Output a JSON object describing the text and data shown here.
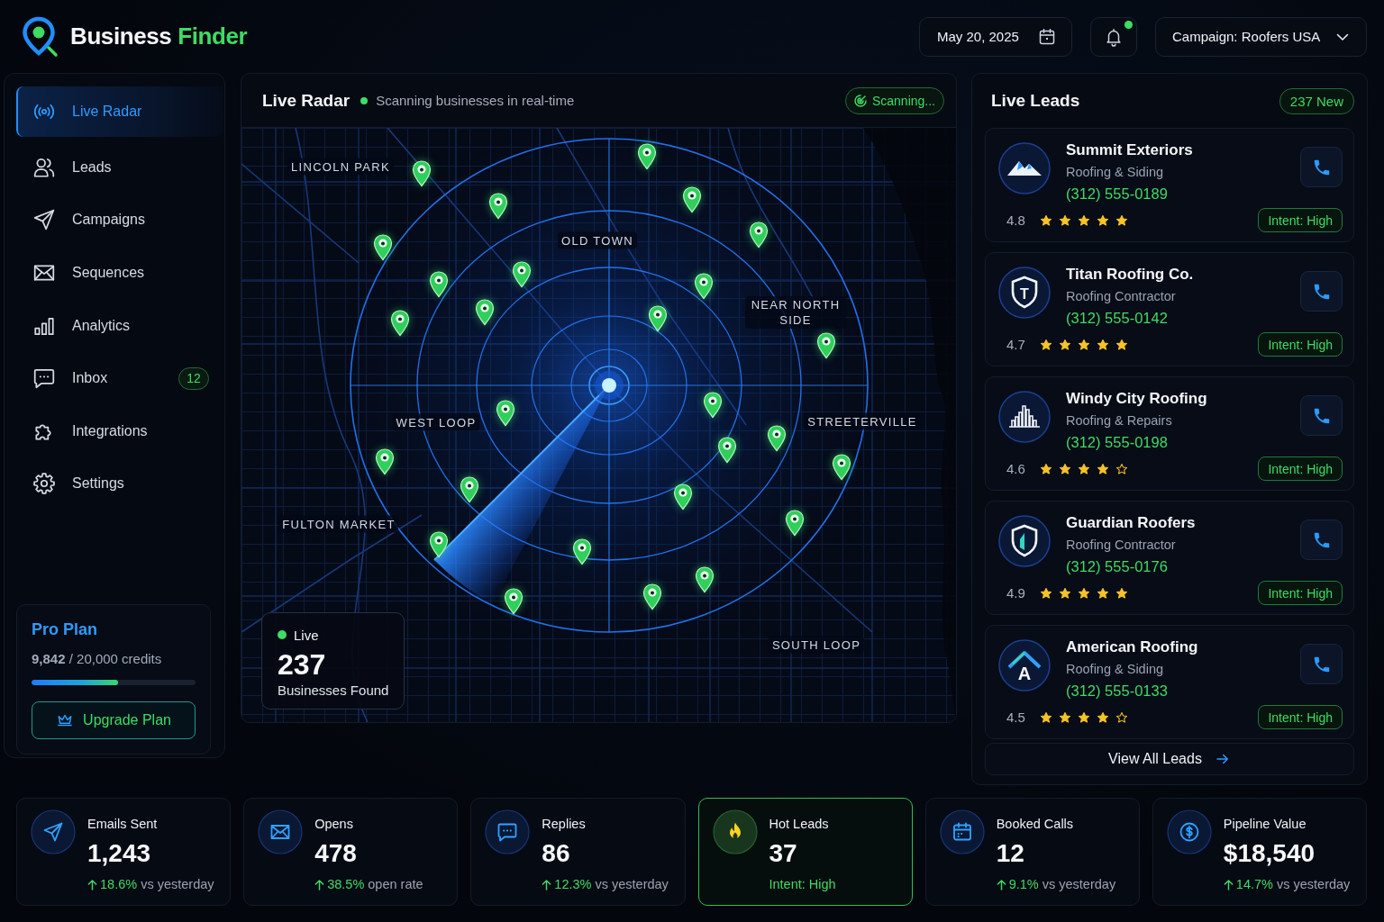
{
  "brand": {
    "name": "Business",
    "accent": "Finder"
  },
  "header": {
    "date": "May 20, 2025",
    "notifications": {
      "unread": true
    },
    "campaign": "Campaign: Roofers USA"
  },
  "sidebar": {
    "items": [
      {
        "label": "Live Radar",
        "selected": true
      },
      {
        "label": "Leads",
        "selected": false
      },
      {
        "label": "Campaigns",
        "selected": false
      },
      {
        "label": "Sequences",
        "selected": false
      },
      {
        "label": "Analytics",
        "selected": false
      },
      {
        "label": "Inbox",
        "selected": false,
        "badge": "12"
      },
      {
        "label": "Integrations",
        "selected": false
      },
      {
        "label": "Settings",
        "selected": false
      }
    ]
  },
  "plan": {
    "name": "Pro Plan",
    "credits": "**9,842** / 20,000 credits",
    "level": 0.53,
    "button": "Upgrade Plan"
  },
  "radar": {
    "title": "Live Radar",
    "subtitle": "Scanning businesses in real-time",
    "status": "Scanning...",
    "map": {
      "area_labels": [
        "LINCOLN PARK",
        "OLD TOWN",
        "NEAR NORTH SIDE",
        "WEST LOOP",
        "STREETERVILLE",
        "FULTON MARKET",
        "SOUTH LOOP"
      ]
    },
    "found": {
      "label": "Live",
      "count": "237",
      "caption": "Businesses Found"
    }
  },
  "leads": {
    "title": "Live Leads",
    "badge": "237 New",
    "items": [
      {
        "name": "Summit Exteriors",
        "category": "Roofing & Siding",
        "phone": "(312) 555-0189",
        "rating": "4.8",
        "stars": 5,
        "intent": "Intent: High"
      },
      {
        "name": "Titan Roofing Co.",
        "category": "Roofing Contractor",
        "phone": "(312) 555-0142",
        "rating": "4.7",
        "stars": 5,
        "intent": "Intent: High",
        "monogram": "T"
      },
      {
        "name": "Windy City Roofing",
        "category": "Roofing & Repairs",
        "phone": "(312) 555-0198",
        "rating": "4.6",
        "stars": 4,
        "intent": "Intent: High"
      },
      {
        "name": "Guardian Roofers",
        "category": "Roofing Contractor",
        "phone": "(312) 555-0176",
        "rating": "4.9",
        "stars": 5,
        "intent": "Intent: High"
      },
      {
        "name": "American Roofing",
        "category": "Roofing & Siding",
        "phone": "(312) 555-0133",
        "rating": "4.5",
        "stars": 4,
        "intent": "Intent: High",
        "monogram": "A"
      }
    ],
    "view_all": "View All Leads"
  },
  "stats": [
    {
      "kind": "trend",
      "label": "Emails Sent",
      "value": "1,243",
      "change": "18.6%",
      "note": "vs yesterday",
      "highlighted": false
    },
    {
      "kind": "trend",
      "label": "Opens",
      "value": "478",
      "change": "38.5%",
      "note": "open rate",
      "highlighted": false
    },
    {
      "kind": "trend",
      "label": "Replies",
      "value": "86",
      "change": "12.3%",
      "note": "vs yesterday",
      "highlighted": false
    },
    {
      "kind": "tag",
      "label": "Hot Leads",
      "value": "37",
      "note": "Intent: High",
      "highlighted": true
    },
    {
      "kind": "trend",
      "label": "Booked Calls",
      "value": "12",
      "change": "9.1%",
      "note": "vs yesterday",
      "highlighted": false
    },
    {
      "kind": "trend",
      "label": "Pipeline Value",
      "value": "$18,540",
      "change": "14.7%",
      "note": "vs yesterday",
      "highlighted": false
    }
  ]
}
